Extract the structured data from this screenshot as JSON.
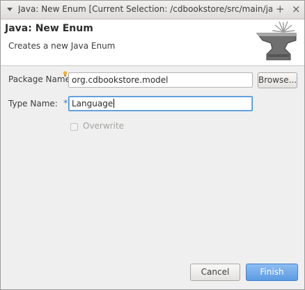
{
  "window": {
    "title": "Java: New Enum [Current Selection: /cdbookstore/src/main/java]",
    "max_glyph": "+",
    "close_glyph": "×"
  },
  "header": {
    "title": "Java: New Enum",
    "description": "Creates a new Java Enum"
  },
  "form": {
    "package_label": "Package Name:",
    "package_value": "org.cdbookstore.model",
    "browse_label": "Browse...",
    "type_label": "Type Name:",
    "type_required_mark": "*",
    "type_value": "Language",
    "overwrite_label": "Overwrite",
    "overwrite_checked": false,
    "overwrite_enabled": false
  },
  "footer": {
    "cancel_label": "Cancel",
    "finish_label": "Finish"
  },
  "colors": {
    "accent": "#5b9be2",
    "required_marker": "#4a7bbf",
    "hint_bulb": "#e8b23a"
  }
}
